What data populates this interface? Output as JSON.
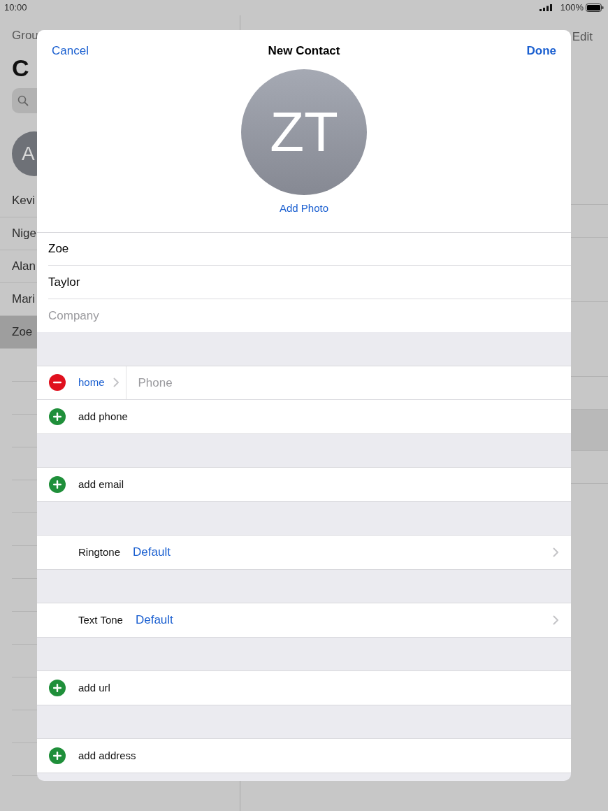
{
  "status_bar": {
    "time": "10:00",
    "battery_text": "100%"
  },
  "background": {
    "back_button": "Grou",
    "title": "C",
    "avatar_initial": "A",
    "edit_button": "Edit",
    "contacts": [
      {
        "name": "Kevi",
        "selected": false
      },
      {
        "name": "Nige",
        "selected": false
      },
      {
        "name": "Alan",
        "selected": false
      },
      {
        "name": "Mari",
        "selected": false
      },
      {
        "name": "Zoe",
        "selected": true
      }
    ]
  },
  "modal": {
    "cancel_button": "Cancel",
    "title": "New Contact",
    "done_button": "Done",
    "avatar_initials": "ZT",
    "add_photo": "Add Photo",
    "name_fields": [
      {
        "value": "Zoe"
      },
      {
        "value": "Taylor"
      },
      {
        "placeholder": "Company"
      }
    ],
    "sections": [
      [
        {
          "kind": "phone",
          "label": "home",
          "placeholder": "Phone"
        },
        {
          "kind": "add",
          "label": "add phone"
        }
      ],
      [
        {
          "kind": "add",
          "label": "add email"
        }
      ],
      [
        {
          "kind": "tone",
          "label": "Ringtone",
          "value": "Default"
        }
      ],
      [
        {
          "kind": "tone",
          "label": "Text Tone",
          "value": "Default"
        }
      ],
      [
        {
          "kind": "add",
          "label": "add url"
        }
      ],
      [
        {
          "kind": "add",
          "label": "add address"
        }
      ]
    ]
  }
}
